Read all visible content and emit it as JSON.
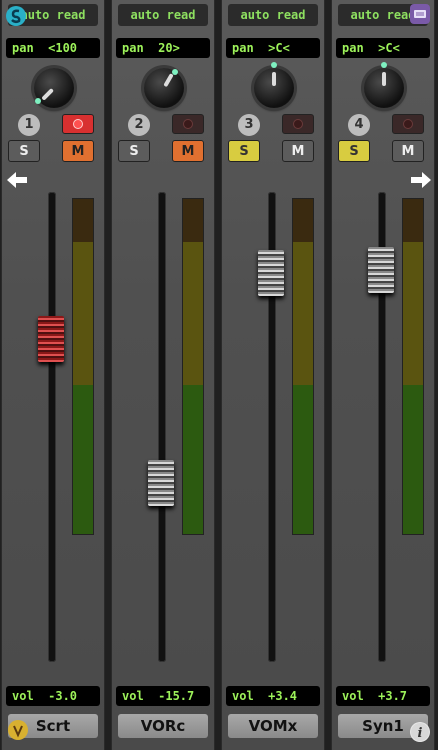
{
  "strips": [
    {
      "number": "1",
      "auto": "auto read",
      "pan": "pan  <100",
      "vol": "vol  -3.0",
      "name": "Scrt"
    },
    {
      "number": "2",
      "auto": "auto read",
      "pan": "pan  20>",
      "vol": "vol  -15.7",
      "name": "VORc"
    },
    {
      "number": "3",
      "auto": "auto read",
      "pan": "pan  >C<",
      "vol": "vol  +3.4",
      "name": "VOMx"
    },
    {
      "number": "4",
      "auto": "auto read",
      "pan": "pan  >C<",
      "vol": "vol  +3.7",
      "name": "Syn1"
    }
  ],
  "buttons": {
    "solo": "S",
    "mute": "M"
  },
  "icons": {
    "left_arrow": "left-arrow-icon",
    "right_arrow": "right-arrow-icon",
    "info": "info-icon",
    "app_logo": "app-logo-icon",
    "menu": "menu-icon",
    "vip_logo": "vip-logo-icon"
  },
  "colors": {
    "lcd_text": "#9df25a",
    "record_on": "#d83030",
    "solo_on": "#d8cc40",
    "mute_on": "#e07030"
  }
}
